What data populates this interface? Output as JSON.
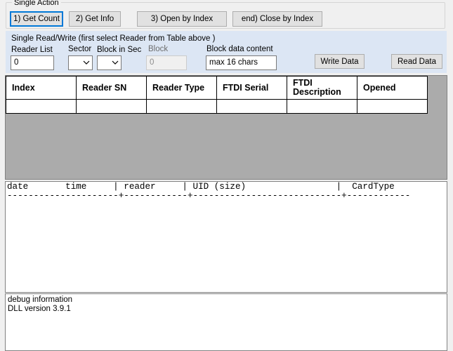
{
  "single_action": {
    "legend": "Single Action",
    "buttons": {
      "get_count": "1) Get Count",
      "get_info": "2) Get Info",
      "open_by_index": "3) Open by Index",
      "close_by_index": "end) Close by Index"
    }
  },
  "read_write": {
    "title": "Single Read/Write  (first select Reader from Table above )",
    "labels": {
      "reader_list": "Reader List",
      "sector": "Sector",
      "block_in_sec": "Block in Sec",
      "block": "Block",
      "block_data": "Block data content"
    },
    "reader_list_value": "0",
    "block_value": "0",
    "block_data_value": "max 16 chars",
    "write_button": "Write Data",
    "read_button": "Read Data"
  },
  "grid": {
    "columns": [
      "Index",
      "Reader SN",
      "Reader Type",
      "FTDI Serial",
      "FTDI Description",
      "Opened"
    ],
    "rows": [
      [
        "",
        "",
        "",
        "",
        "",
        ""
      ]
    ]
  },
  "card_log": {
    "header": "date       time     | reader     | UID (size)                 |  CardType",
    "separator": "---------------------+------------+----------------------------+------------"
  },
  "debug": {
    "text": "debug information\nDLL version 3.9.1"
  }
}
